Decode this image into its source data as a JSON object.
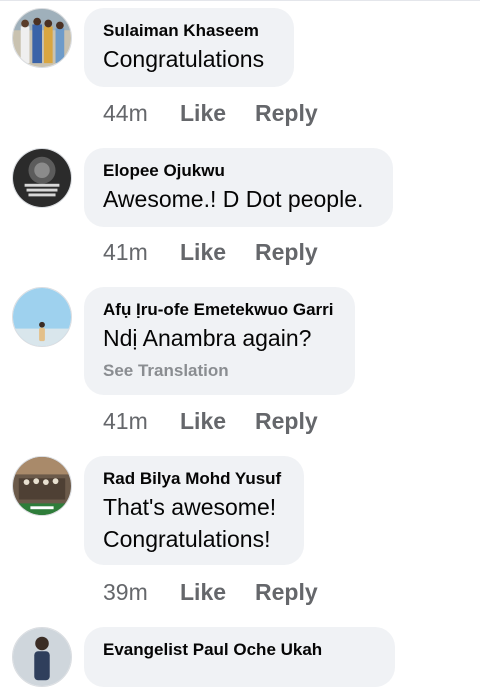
{
  "comments": [
    {
      "author": "Sulaiman Khaseem",
      "lines": [
        "Congratulations"
      ],
      "time": "44m",
      "like_label": "Like",
      "reply_label": "Reply"
    },
    {
      "author": "Elopee Ojukwu",
      "lines": [
        "Awesome.! D Dot people."
      ],
      "time": "41m",
      "like_label": "Like",
      "reply_label": "Reply"
    },
    {
      "author": "Afụ Ịru-ofe Emetekwuo Garri",
      "lines": [
        "Ndị Anambra again?"
      ],
      "see_translation": "See Translation",
      "time": "41m",
      "like_label": "Like",
      "reply_label": "Reply"
    },
    {
      "author": "Rad Bilya Mohd Yusuf",
      "lines": [
        "That's awesome!",
        "Congratulations!"
      ],
      "time": "39m",
      "like_label": "Like",
      "reply_label": "Reply"
    },
    {
      "author": "Evangelist Paul Oche Ukah"
    }
  ],
  "colors": {
    "bubble_bg": "#f0f2f5",
    "name_text": "#050505",
    "meta_text": "#65676b",
    "see_translation": "#8a8d91"
  },
  "icons": [
    "avatar-photo-group",
    "avatar-lion-poster",
    "avatar-sky-person",
    "avatar-ceremony",
    "avatar-person"
  ]
}
